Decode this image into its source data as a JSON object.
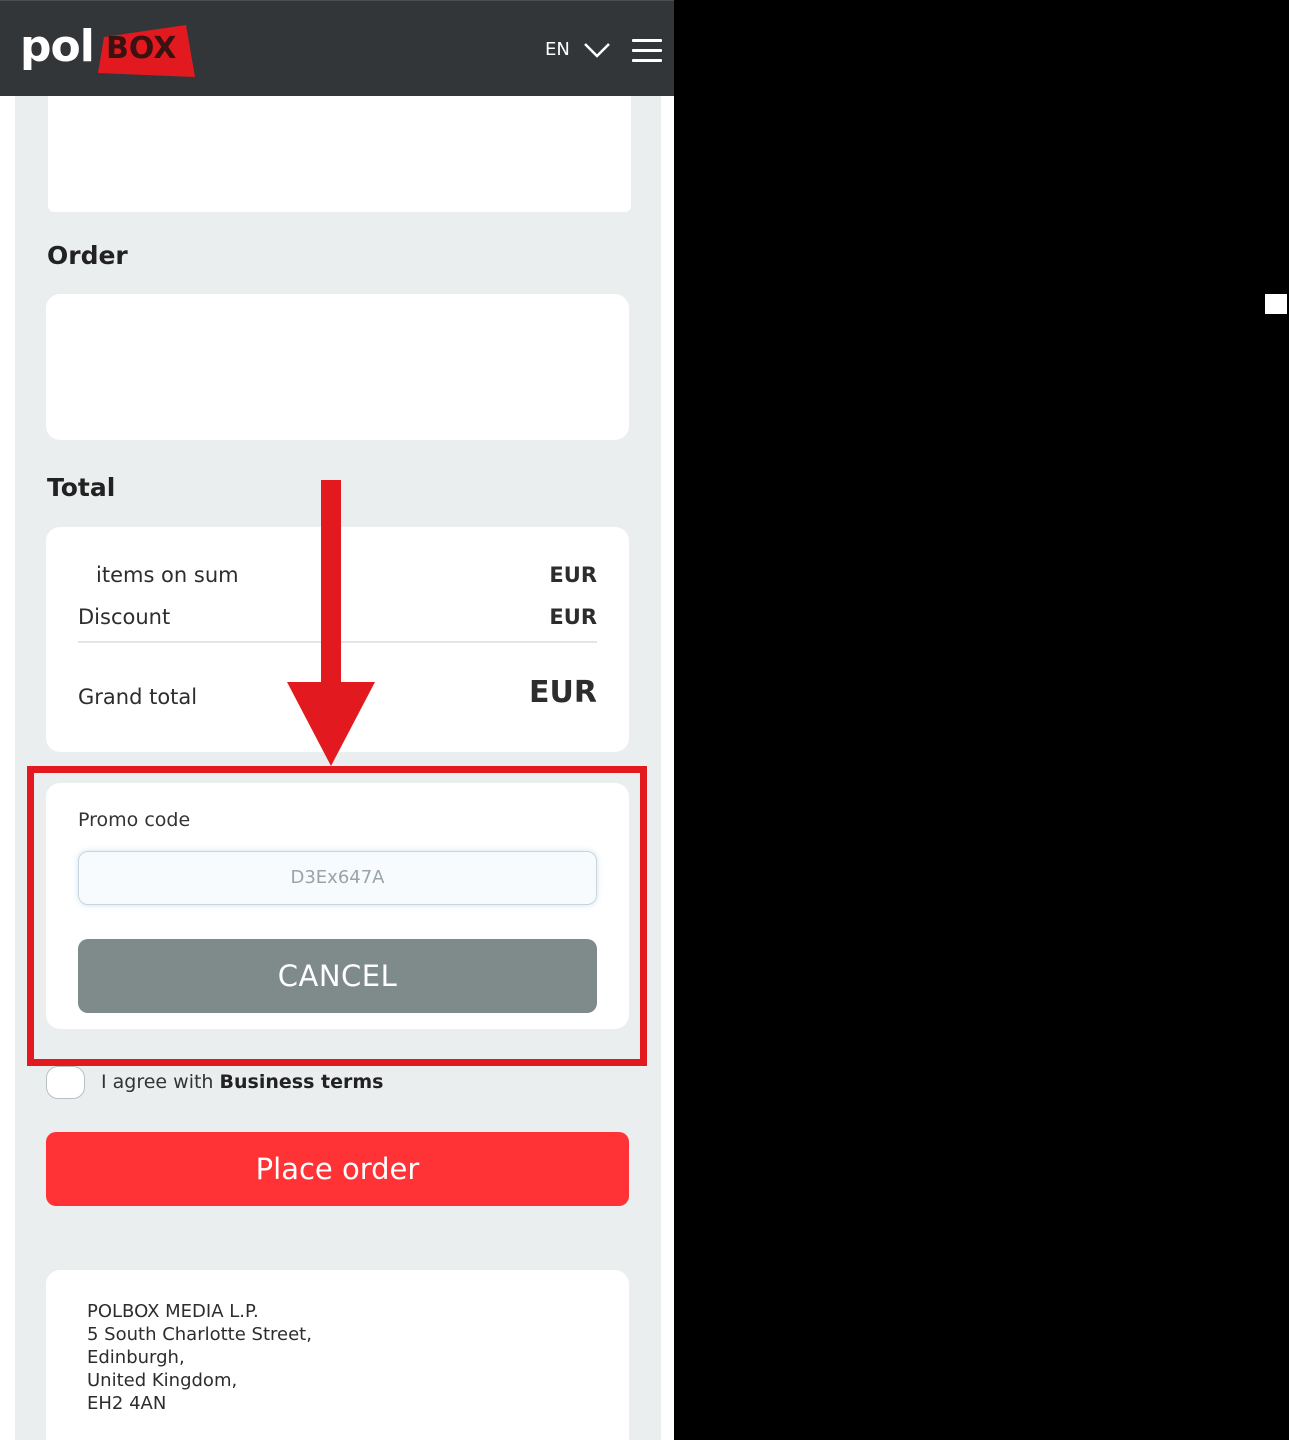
{
  "header": {
    "logo_text_pol": "pol",
    "logo_text_box": "BOX",
    "language": "EN"
  },
  "order": {
    "heading": "Order"
  },
  "total": {
    "heading": "Total",
    "items_label": "items on sum",
    "items_value": "EUR",
    "discount_label": "Discount",
    "discount_value": "EUR",
    "grand_label": "Grand total",
    "grand_value": "EUR"
  },
  "promo": {
    "label": "Promo code",
    "code_value": "D3Ex647A",
    "cancel_label": "CANCEL"
  },
  "agree": {
    "text": "I agree with",
    "link": "Business terms"
  },
  "place_order_label": "Place order",
  "address": {
    "line1": "POLBOX MEDIA L.P.",
    "line2": "5 South Charlotte Street,",
    "line3": "Edinburgh,",
    "line4": "United Kingdom,",
    "line5": "EH2 4AN"
  },
  "colors": {
    "header_bg": "#323638",
    "brand_red": "#e21a1f",
    "place_order": "#ff3236",
    "cancel_gray": "#7f8b8b",
    "page_bg": "#ebeeef"
  },
  "icons": [
    "polbox-logo",
    "chevron-down-icon",
    "hamburger-menu-icon",
    "annotation-arrow-icon"
  ]
}
